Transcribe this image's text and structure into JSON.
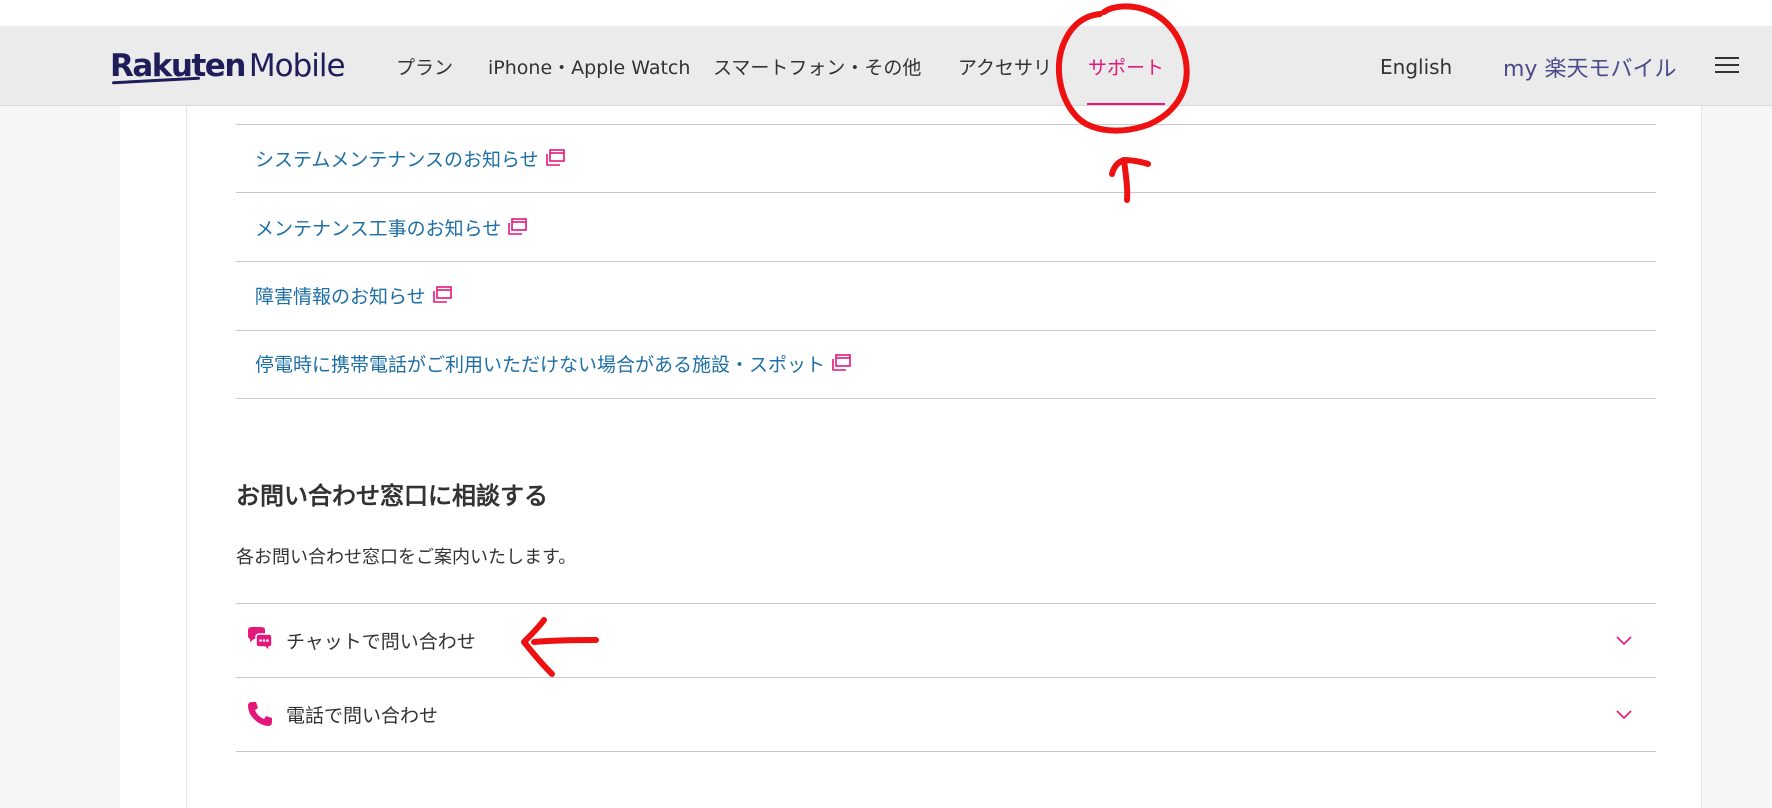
{
  "header": {
    "logo_brand": "Rakuten",
    "logo_product": "Mobile",
    "nav": [
      {
        "label": "プラン"
      },
      {
        "label": "iPhone・Apple Watch"
      },
      {
        "label": "スマートフォン・その他"
      },
      {
        "label": "アクセサリ"
      },
      {
        "label": "サポート",
        "active": true
      }
    ],
    "english_label": "English",
    "my_rakuten_label": "my 楽天モバイル"
  },
  "info_links": [
    {
      "label": "システムメンテナンスのお知らせ"
    },
    {
      "label": "メンテナンス工事のお知らせ"
    },
    {
      "label": "障害情報のお知らせ"
    },
    {
      "label": "停電時に携帯電話がご利用いただけない場合がある施設・スポット"
    }
  ],
  "contact": {
    "title": "お問い合わせ窓口に相談する",
    "description": "各お問い合わせ窓口をご案内いたします。",
    "items": [
      {
        "label": "チャットで問い合わせ",
        "icon": "chat-bubbles-icon"
      },
      {
        "label": "電話で問い合わせ",
        "icon": "phone-icon"
      }
    ]
  },
  "colors": {
    "accent": "#e3187a",
    "link": "#1d6fa6",
    "brand": "#1f1d5a",
    "annotation": "#ee1111"
  }
}
